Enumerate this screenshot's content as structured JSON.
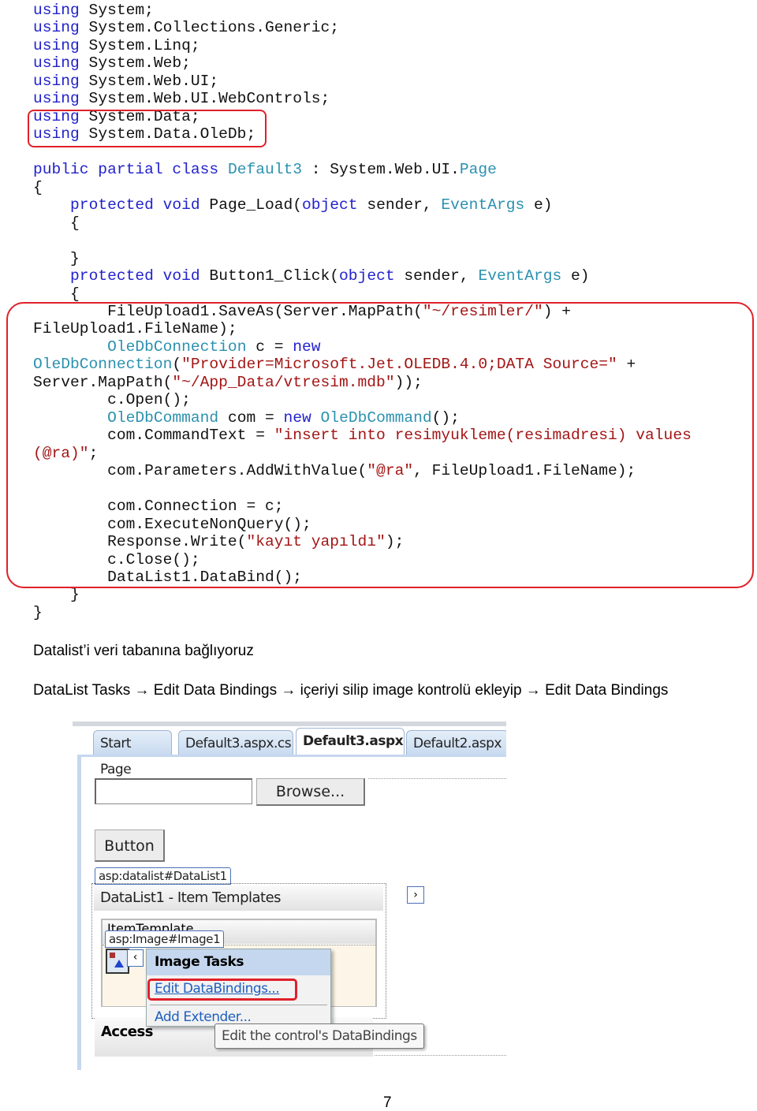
{
  "code_lines": [
    [
      [
        "using",
        "kw"
      ],
      [
        " System;",
        ""
      ]
    ],
    [
      [
        "using",
        "kw"
      ],
      [
        " System.Collections.Generic;",
        ""
      ]
    ],
    [
      [
        "using",
        "kw"
      ],
      [
        " System.Linq;",
        ""
      ]
    ],
    [
      [
        "using",
        "kw"
      ],
      [
        " System.Web;",
        ""
      ]
    ],
    [
      [
        "using",
        "kw"
      ],
      [
        " System.Web.UI;",
        ""
      ]
    ],
    [
      [
        "using",
        "kw"
      ],
      [
        " System.Web.UI.WebControls;",
        ""
      ]
    ],
    [
      [
        "using",
        "kw"
      ],
      [
        " System.Data;",
        ""
      ]
    ],
    [
      [
        "using",
        "kw"
      ],
      [
        " System.Data.OleDb;",
        ""
      ]
    ],
    [],
    [
      [
        "public partial class",
        "kw"
      ],
      [
        " ",
        ""
      ],
      [
        "Default3",
        "ty"
      ],
      [
        " : System.Web.UI.",
        ""
      ],
      [
        "Page",
        "ty"
      ]
    ],
    [
      [
        "{",
        ""
      ]
    ],
    [
      [
        "    ",
        ""
      ],
      [
        "protected void",
        "kw"
      ],
      [
        " Page_Load(",
        ""
      ],
      [
        "object",
        "kw"
      ],
      [
        " sender, ",
        ""
      ],
      [
        "EventArgs",
        "ty"
      ],
      [
        " e)",
        ""
      ]
    ],
    [
      [
        "    {",
        ""
      ]
    ],
    [],
    [
      [
        "    }",
        ""
      ]
    ],
    [
      [
        "    ",
        ""
      ],
      [
        "protected void",
        "kw"
      ],
      [
        " Button1_Click(",
        ""
      ],
      [
        "object",
        "kw"
      ],
      [
        " sender, ",
        ""
      ],
      [
        "EventArgs",
        "ty"
      ],
      [
        " e)",
        ""
      ]
    ],
    [
      [
        "    {",
        ""
      ]
    ],
    [
      [
        "        FileUpload1.SaveAs(Server.MapPath(",
        ""
      ],
      [
        "\"~/resimler/\"",
        "st"
      ],
      [
        ") +",
        ""
      ]
    ],
    [
      [
        "FileUpload1.FileName);",
        ""
      ]
    ],
    [
      [
        "        ",
        ""
      ],
      [
        "OleDbConnection",
        "ty"
      ],
      [
        " c = ",
        ""
      ],
      [
        "new",
        "kw"
      ]
    ],
    [
      [
        "OleDbConnection",
        "ty"
      ],
      [
        "(",
        ""
      ],
      [
        "\"Provider=Microsoft.Jet.OLEDB.4.0;DATA Source=\"",
        "st"
      ],
      [
        " +",
        ""
      ]
    ],
    [
      [
        "Server.MapPath(",
        ""
      ],
      [
        "\"~/App_Data/vtresim.mdb\"",
        "st"
      ],
      [
        "));",
        ""
      ]
    ],
    [
      [
        "        c.Open();",
        ""
      ]
    ],
    [
      [
        "        ",
        ""
      ],
      [
        "OleDbCommand",
        "ty"
      ],
      [
        " com = ",
        ""
      ],
      [
        "new",
        "kw"
      ],
      [
        " ",
        ""
      ],
      [
        "OleDbCommand",
        "ty"
      ],
      [
        "();",
        ""
      ]
    ],
    [
      [
        "        com.CommandText = ",
        ""
      ],
      [
        "\"insert into resimyukleme(resimadresi) values",
        "st"
      ]
    ],
    [
      [
        "(@ra)\"",
        "st"
      ],
      [
        ";",
        ""
      ]
    ],
    [
      [
        "        com.Parameters.AddWithValue(",
        ""
      ],
      [
        "\"@ra\"",
        "st"
      ],
      [
        ", FileUpload1.FileName);",
        ""
      ]
    ],
    [],
    [
      [
        "        com.Connection = c;",
        ""
      ]
    ],
    [
      [
        "        com.ExecuteNonQuery();",
        ""
      ]
    ],
    [
      [
        "        Response.Write(",
        ""
      ],
      [
        "\"kayıt yapıldı\"",
        "st"
      ],
      [
        ");",
        ""
      ]
    ],
    [
      [
        "        c.Close();",
        ""
      ]
    ],
    [
      [
        "        DataList1.DataBind();",
        ""
      ]
    ],
    [
      [
        "    }",
        ""
      ]
    ],
    [
      [
        "}",
        ""
      ]
    ]
  ],
  "paragraphs": {
    "p1": "Datalist’i veri tabanına bağlıyoruz",
    "p2": "DataList Tasks → Edit Data Bindings → içeriyi silip image kontrolü ekleyip → Edit Data Bindings"
  },
  "screenshot": {
    "tabs": [
      "Start Page",
      "Default3.aspx.cs",
      "Default3.aspx",
      "Default2.aspx"
    ],
    "active_tab": "Default3.aspx",
    "browse_label": "Browse...",
    "button_label": "Button",
    "datalist_tag": "asp:datalist#DataList1",
    "datalist_header": "DataList1 - Item Templates",
    "item_template_label": "ItemTemplate",
    "image_tag": "asp:Image#Image1",
    "image_tasks_title": "Image Tasks",
    "edit_databindings": "Edit DataBindings...",
    "add_extender": "Add Extender...",
    "tooltip": "Edit the control's DataBindings",
    "access_label": "Access"
  },
  "page_number": "7",
  "colors": {
    "keyword": "#2222cc",
    "type": "#2b91af",
    "string": "#a31515",
    "highlight": "#e0202a"
  }
}
